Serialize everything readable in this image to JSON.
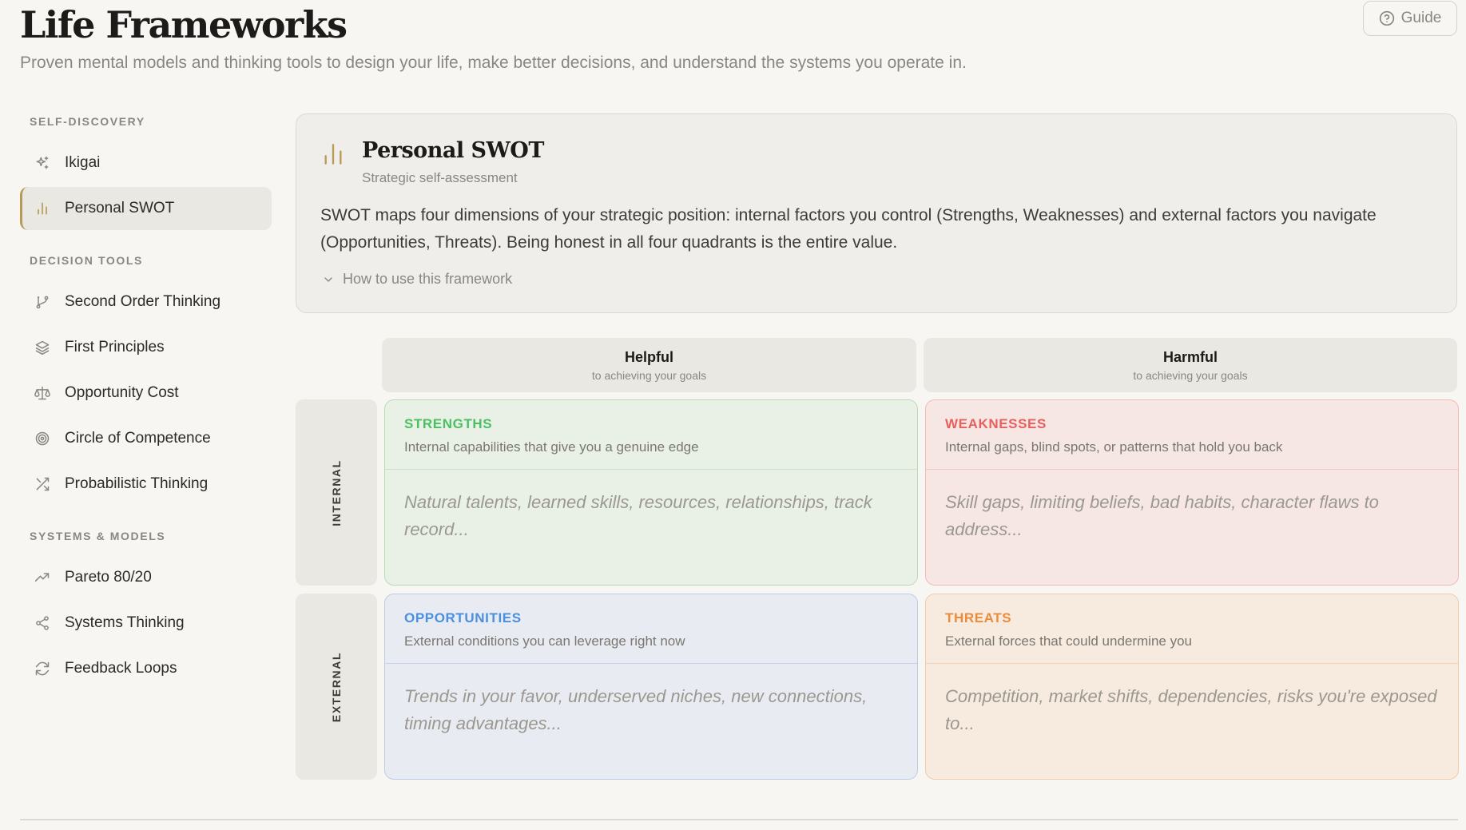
{
  "header": {
    "title": "Life Frameworks",
    "subtitle": "Proven mental models and thinking tools to design your life, make better decisions, and understand the systems you operate in.",
    "guide_label": "Guide"
  },
  "sidebar": {
    "sections": [
      {
        "label": "SELF-DISCOVERY",
        "items": [
          {
            "label": "Ikigai",
            "icon": "sparkles-icon"
          },
          {
            "label": "Personal SWOT",
            "icon": "bar-chart-icon",
            "active": true
          }
        ]
      },
      {
        "label": "DECISION TOOLS",
        "items": [
          {
            "label": "Second Order Thinking",
            "icon": "git-branch-icon"
          },
          {
            "label": "First Principles",
            "icon": "layers-icon"
          },
          {
            "label": "Opportunity Cost",
            "icon": "scale-icon"
          },
          {
            "label": "Circle of Competence",
            "icon": "target-icon"
          },
          {
            "label": "Probabilistic Thinking",
            "icon": "shuffle-icon"
          }
        ]
      },
      {
        "label": "SYSTEMS & MODELS",
        "items": [
          {
            "label": "Pareto 80/20",
            "icon": "trending-up-icon"
          },
          {
            "label": "Systems Thinking",
            "icon": "share-nodes-icon"
          },
          {
            "label": "Feedback Loops",
            "icon": "refresh-icon"
          }
        ]
      }
    ]
  },
  "framework": {
    "title": "Personal SWOT",
    "subtitle": "Strategic self-assessment",
    "description": "SWOT maps four dimensions of your strategic position: internal factors you control (Strengths, Weaknesses) and external factors you navigate (Opportunities, Threats). Being honest in all four quadrants is the entire value.",
    "how_to_label": "How to use this framework",
    "accent": "#b79a54"
  },
  "matrix": {
    "columns": [
      {
        "title": "Helpful",
        "subtitle": "to achieving your goals"
      },
      {
        "title": "Harmful",
        "subtitle": "to achieving your goals"
      }
    ],
    "rows": [
      "INTERNAL",
      "EXTERNAL"
    ],
    "quadrants": {
      "strengths": {
        "title": "STRENGTHS",
        "description": "Internal capabilities that give you a genuine edge",
        "placeholder": "Natural talents, learned skills, resources, relationships, track record...",
        "color": "#4cbf63"
      },
      "weaknesses": {
        "title": "WEAKNESSES",
        "description": "Internal gaps, blind spots, or patterns that hold you back",
        "placeholder": "Skill gaps, limiting beliefs, bad habits, character flaws to address...",
        "color": "#e8605c"
      },
      "opportunities": {
        "title": "OPPORTUNITIES",
        "description": "External conditions you can leverage right now",
        "placeholder": "Trends in your favor, underserved niches, new connections, timing advantages...",
        "color": "#4a8fe0"
      },
      "threats": {
        "title": "THREATS",
        "description": "External forces that could undermine you",
        "placeholder": "Competition, market shifts, dependencies, risks you're exposed to...",
        "color": "#eb8c3a"
      }
    }
  }
}
